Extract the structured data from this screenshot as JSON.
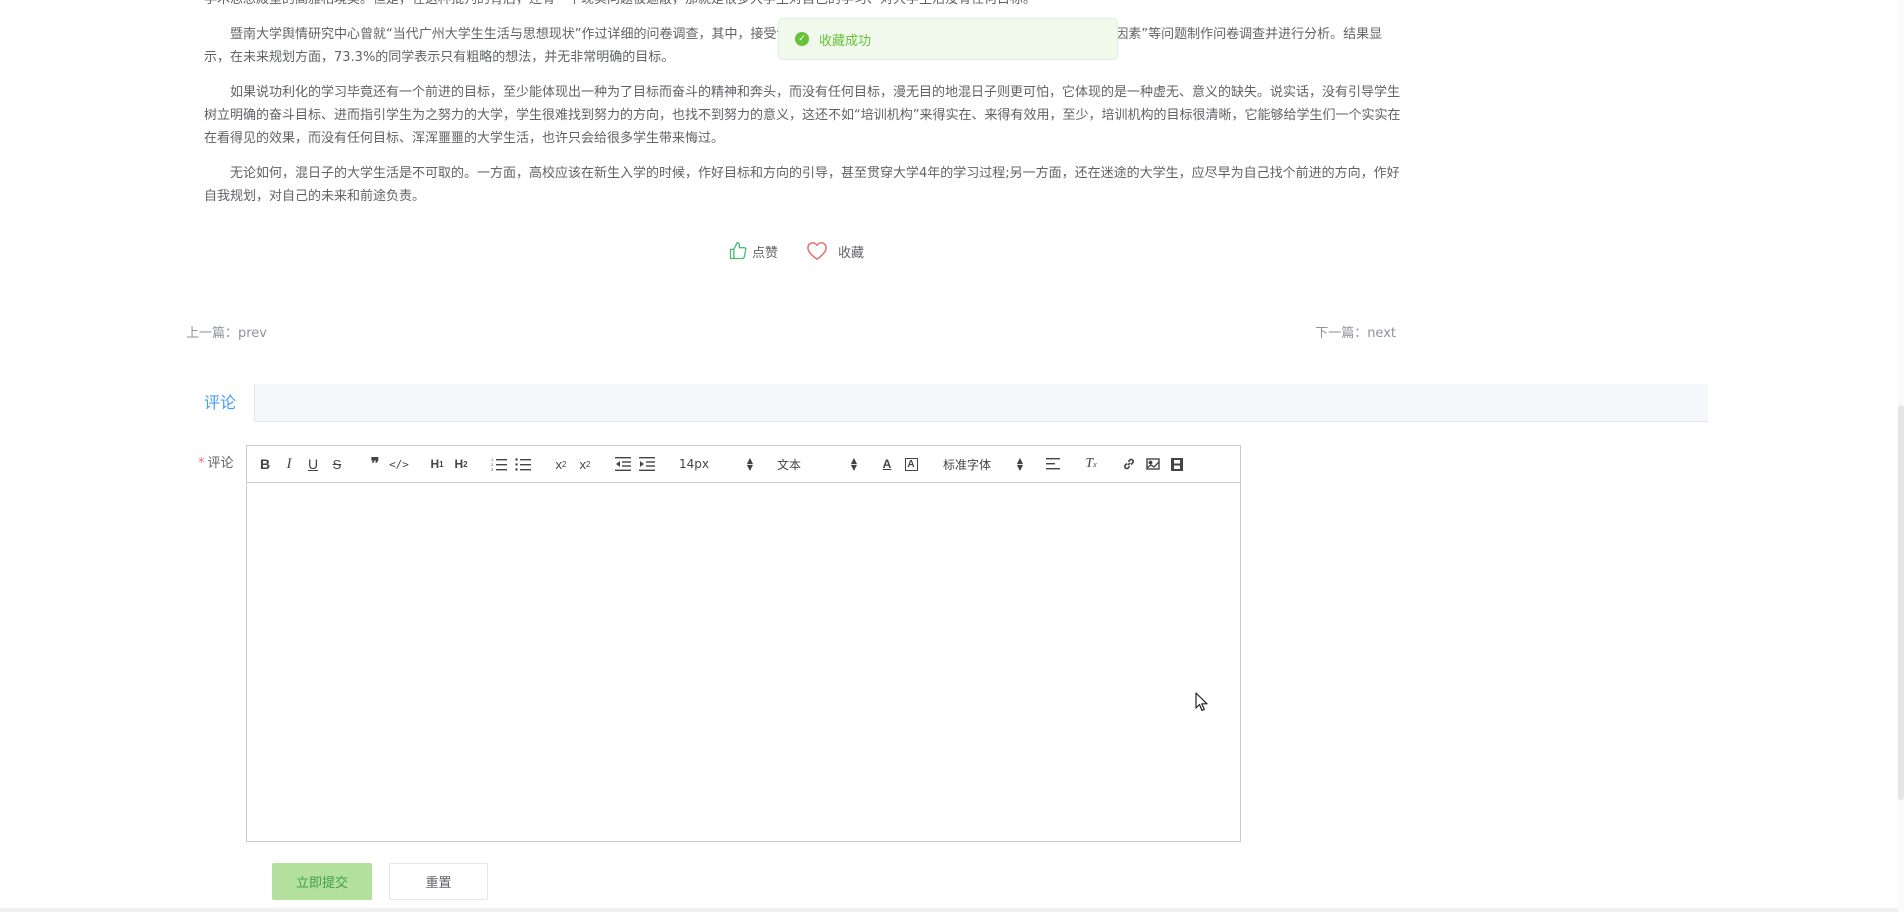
{
  "article": {
    "p1": "学术思想殿堂的高雅相境美。但是，在这种批判的背后，还有一个现实问题被遮蔽，那就是很多大学生对自己的学习、对大学生活没有任何目标。",
    "p2": "暨南大学舆情研究中心曾就“当代广州大学生生活与思想现状”作过详细的问卷调查，其中，接受调查的学生……的原因”、“大学第一印象”、“专业选择首要因素”等问题制作问卷调查并进行分析。结果显示，在未来规划方面，73.3%的同学表示只有粗略的想法，并无非常明确的目标。",
    "p3": "如果说功利化的学习毕竟还有一个前进的目标，至少能体现出一种为了目标而奋斗的精神和奔头，而没有任何目标，漫无目的地混日子则更可怕，它体现的是一种虚无、意义的缺失。说实话，没有引导学生树立明确的奋斗目标、进而指引学生为之努力的大学，学生很难找到努力的方向，也找不到努力的意义，这还不如“培训机构”来得实在、来得有效用，至少，培训机构的目标很清晰，它能够给学生们一个实实在在看得见的效果，而没有任何目标、浑浑噩噩的大学生活，也许只会给很多学生带来悔过。",
    "p4": "无论如何，混日子的大学生活是不可取的。一方面，高校应该在新生入学的时候，作好目标和方向的引导，甚至贯穿大学4年的学习过程;另一方面，还在迷途的大学生，应尽早为自己找个前进的方向，作好自我规划，对自己的未来和前途负责。"
  },
  "toast": {
    "message": "收藏成功"
  },
  "actions": {
    "like_label": "点赞",
    "favorite_label": "收藏"
  },
  "pager": {
    "prev": "上一篇：prev",
    "next": "下一篇：next"
  },
  "comment": {
    "tab_label": "评论",
    "field_label": "评论",
    "required_mark": "*"
  },
  "toolbar": {
    "font_size": "14px",
    "header": "文本",
    "font_family": "标准字体"
  },
  "buttons": {
    "submit": "立即提交",
    "reset": "重置"
  },
  "colors": {
    "accent": "#409eff",
    "success": "#67c23a",
    "submit_bg": "#b3e19d",
    "like_icon": "#4cb87a",
    "favorite_icon": "#e86a6a"
  }
}
